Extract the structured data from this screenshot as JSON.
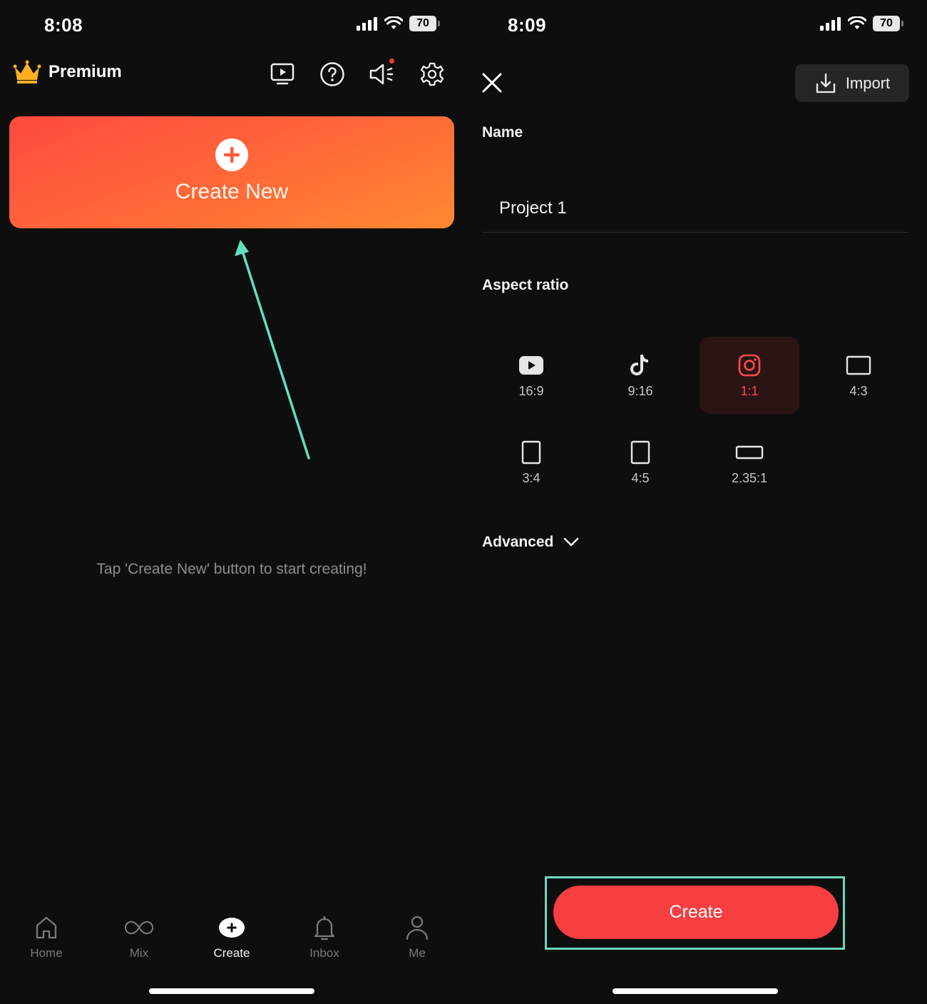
{
  "left": {
    "status": {
      "time": "8:08",
      "battery": "70"
    },
    "header": {
      "premium_label": "Premium"
    },
    "create_card": {
      "label": "Create New"
    },
    "hint": "Tap 'Create New' button to start creating!",
    "nav": [
      {
        "label": "Home",
        "icon": "home-icon"
      },
      {
        "label": "Mix",
        "icon": "infinity-icon"
      },
      {
        "label": "Create",
        "icon": "plus-circle-icon",
        "active": true
      },
      {
        "label": "Inbox",
        "icon": "bell-icon"
      },
      {
        "label": "Me",
        "icon": "person-icon"
      }
    ]
  },
  "right": {
    "status": {
      "time": "8:09",
      "battery": "70"
    },
    "import_label": "Import",
    "name_label": "Name",
    "name_value": "Project 1",
    "aspect_label": "Aspect ratio",
    "ratios": [
      {
        "label": "16:9",
        "icon": "youtube-icon"
      },
      {
        "label": "9:16",
        "icon": "tiktok-icon"
      },
      {
        "label": "1:1",
        "icon": "instagram-icon",
        "selected": true
      },
      {
        "label": "4:3",
        "icon": "landscape-rect-icon"
      },
      {
        "label": "3:4",
        "icon": "portrait-rect-icon"
      },
      {
        "label": "4:5",
        "icon": "portrait-rect-icon"
      },
      {
        "label": "2.35:1",
        "icon": "wide-rect-icon"
      }
    ],
    "advanced_label": "Advanced",
    "create_label": "Create"
  },
  "colors": {
    "accent_red": "#f73e41",
    "highlight_teal": "#6ed8bf",
    "card_gradient_start": "#ff4a40",
    "card_gradient_end": "#ff8a32"
  }
}
